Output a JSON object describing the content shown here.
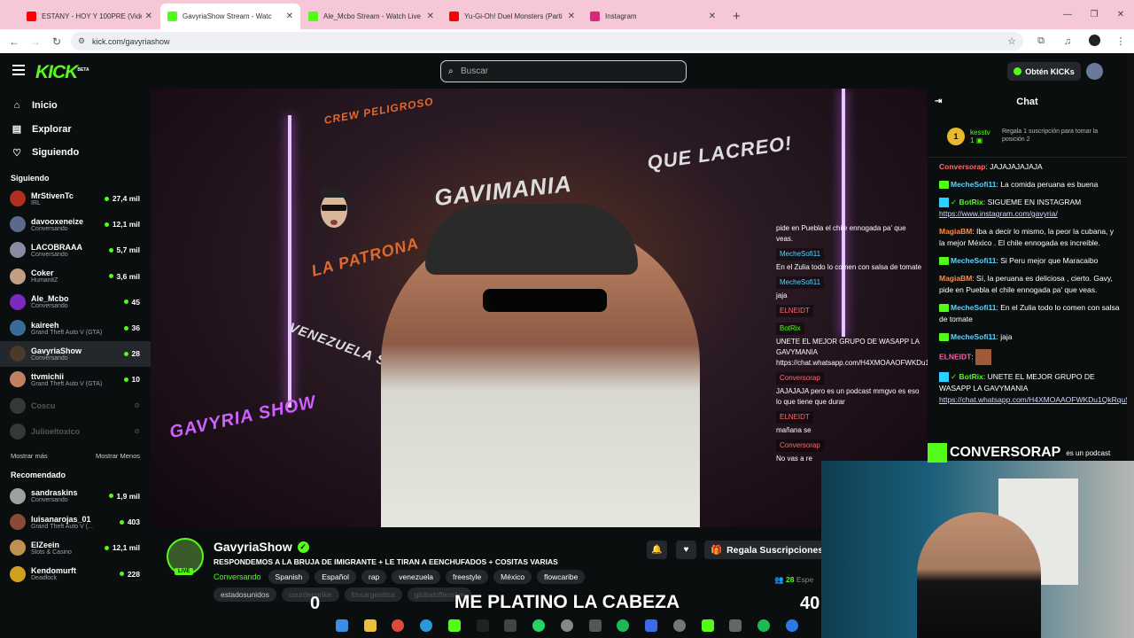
{
  "browser": {
    "tabs": [
      {
        "title": "ESTANY - HOY Y 100PRE (Video",
        "color": "#ff0000",
        "active": false
      },
      {
        "title": "GavyriaShow Stream - Watc",
        "color": "#53fc18",
        "active": true
      },
      {
        "title": "Ale_Mcbo Stream - Watch Live",
        "color": "#53fc18",
        "active": false
      },
      {
        "title": "Yu-Gi-Oh! Duel Monsters (Parti",
        "color": "#ff0000",
        "active": false
      },
      {
        "title": "Instagram",
        "color": "#d62976",
        "active": false
      }
    ],
    "url": "kick.com/gavyriashow"
  },
  "header": {
    "logo": "KICK",
    "logo_sup": "BETA",
    "search_placeholder": "Buscar",
    "obtain_label": "Obtén KICKs"
  },
  "nav": [
    {
      "label": "Inicio",
      "icon": "⌂"
    },
    {
      "label": "Explorar",
      "icon": "▤"
    },
    {
      "label": "Siguiendo",
      "icon": "♡"
    }
  ],
  "following": {
    "title": "Siguiendo",
    "channels": [
      {
        "name": "MrStivenTc",
        "category": "IRL",
        "viewers": "27,4 mil",
        "color": "#b03020"
      },
      {
        "name": "davooxeneize",
        "category": "Conversando",
        "viewers": "12,1 mil",
        "color": "#5a6a8a"
      },
      {
        "name": "LACOBRAAA",
        "category": "Conversando",
        "viewers": "5,7 mil",
        "color": "#8a8aa0"
      },
      {
        "name": "Coker",
        "category": "HumanitZ",
        "viewers": "3,6 mil",
        "color": "#c0a080"
      },
      {
        "name": "Ale_Mcbo",
        "category": "Conversando",
        "viewers": "45",
        "color": "#7a2ac0"
      },
      {
        "name": "kaireeh",
        "category": "Grand Theft Auto V (GTA)",
        "viewers": "36",
        "color": "#3a6a9a"
      },
      {
        "name": "GavyriaShow",
        "category": "Conversando",
        "viewers": "28",
        "color": "#4a3a2a"
      },
      {
        "name": "ttvmichii",
        "category": "Grand Theft Auto V (GTA)",
        "viewers": "10",
        "color": "#c08060"
      },
      {
        "name": "Coscu",
        "category": "",
        "viewers": "",
        "color": "#777"
      },
      {
        "name": "Julioeltoxico",
        "category": "",
        "viewers": "",
        "color": "#777"
      }
    ],
    "show_more": "Mostrar más",
    "show_less": "Mostrar Menos"
  },
  "recommended": {
    "title": "Recomendado",
    "channels": [
      {
        "name": "sandraskins",
        "category": "Conversando",
        "viewers": "1,9 mil",
        "color": "#a0a0a0"
      },
      {
        "name": "luisanarojas_01",
        "category": "Grand Theft Auto V (...",
        "viewers": "403",
        "color": "#8a4a3a"
      },
      {
        "name": "ElZeein",
        "category": "Slots & Casino",
        "viewers": "12,1 mil",
        "color": "#c09050"
      },
      {
        "name": "Kendomurft",
        "category": "Deadlock",
        "viewers": "228",
        "color": "#d0a020"
      }
    ]
  },
  "video": {
    "graffiti": [
      "QUE LACREO!",
      "GAVIMANIA",
      "CREW PELIGROSO",
      "LA PATRONA",
      "VENEZUELA SUBTERRANEA",
      "GAVYRIA SHOW"
    ],
    "overlay_chat": [
      {
        "user": "",
        "text": "pide en Puebla el chile ennogada pa' que veas."
      },
      {
        "user": "MecheSofi11",
        "text": "En el Zulia todo lo comen con salsa de tomate"
      },
      {
        "user": "MecheSofi11",
        "text": "jaja"
      },
      {
        "user": "ELNEIDT",
        "text": ""
      },
      {
        "user": "BotRix",
        "text": "UNETE EL MEJOR GRUPO DE WASAPP LA GAVYMANIA https://chat.whatsapp.com/H4XMOAAOFWKDu1QkRquSm0"
      },
      {
        "user": "Conversorap",
        "text": "JAJAJAJA pero es un podcast mmgvo es eso lo que tiene que durar"
      },
      {
        "user": "ELNEIDT",
        "text": "mañana se"
      },
      {
        "user": "Conversorap",
        "text": "No vas a re"
      }
    ]
  },
  "stream": {
    "channel": "GavyriaShow",
    "live": "LIVE",
    "title": "RESPONDEMOS A LA BRUJA DE IMIGRANTE + LE TIRAN A EENCHUFADOS + COSITAS VARIAS",
    "category": "Conversando",
    "tags": [
      "Spanish",
      "Español",
      "rap",
      "venezuela",
      "freestyle",
      "México",
      "flowcaribe"
    ],
    "tags2": [
      "estadosunidos",
      "counterstrike",
      "fmsargentina",
      "globaloffensive"
    ],
    "gift_label": "Regala Suscripciones",
    "viewers": "28",
    "viewers_suffix": "Espe"
  },
  "chat": {
    "title": "Chat",
    "pinned_user": "kesstv",
    "pinned_count": "1",
    "pinned_rank": "1",
    "pinned_msg": "Regala 1 suscripción para tomar la posición 2",
    "messages": [
      {
        "user": "Conversorap",
        "color": "#ff6b6b",
        "text": "JAJAJAJAJAJA",
        "badge": ""
      },
      {
        "user": "MecheSofi11",
        "color": "#58d5ff",
        "text": "La comida peruana es buena",
        "badge": "k"
      },
      {
        "user": "BotRix",
        "color": "#53fc18",
        "text": "SIGUEME EN INSTAGRAM",
        "link": "https://www.instagram.com/gavyria/",
        "badge": "bot"
      },
      {
        "user": "MagiaBM",
        "color": "#ff8c42",
        "text": "Iba a decir lo mismo, la peor la cubana, y la mejor México . El chile ennogada es increible.",
        "badge": ""
      },
      {
        "user": "MecheSofi11",
        "color": "#58d5ff",
        "text": "Si Peru mejor que Maracaibo",
        "badge": "k"
      },
      {
        "user": "MagiaBM",
        "color": "#ff8c42",
        "text": "Sí, la peruana es deliciosa , cierto. Gavy, pide en Puebla el chile ennogada pa' que veas.",
        "badge": ""
      },
      {
        "user": "MecheSofi11",
        "color": "#58d5ff",
        "text": "En el Zulia todo lo comen con salsa de tomate",
        "badge": "k"
      },
      {
        "user": "MecheSofi11",
        "color": "#58d5ff",
        "text": "jaja",
        "badge": "k"
      },
      {
        "user": "ELNEIDT",
        "color": "#ff5ea8",
        "text": "",
        "badge": "emote"
      },
      {
        "user": "BotRix",
        "color": "#53fc18",
        "text": "UNETE EL MEJOR GRUPO DE WASAPP LA GAVYMANIA",
        "link": "https://chat.whatsapp.com/H4XMOAAOFWKDu1QkRquSm0",
        "badge": "bot"
      }
    ]
  },
  "overlay": {
    "cam_name": "CONVERSORAP",
    "cam_behind": "es un podcast",
    "subtitle": "ME PLATINO LA CABEZA",
    "score_left": "0",
    "score_right": "40"
  }
}
